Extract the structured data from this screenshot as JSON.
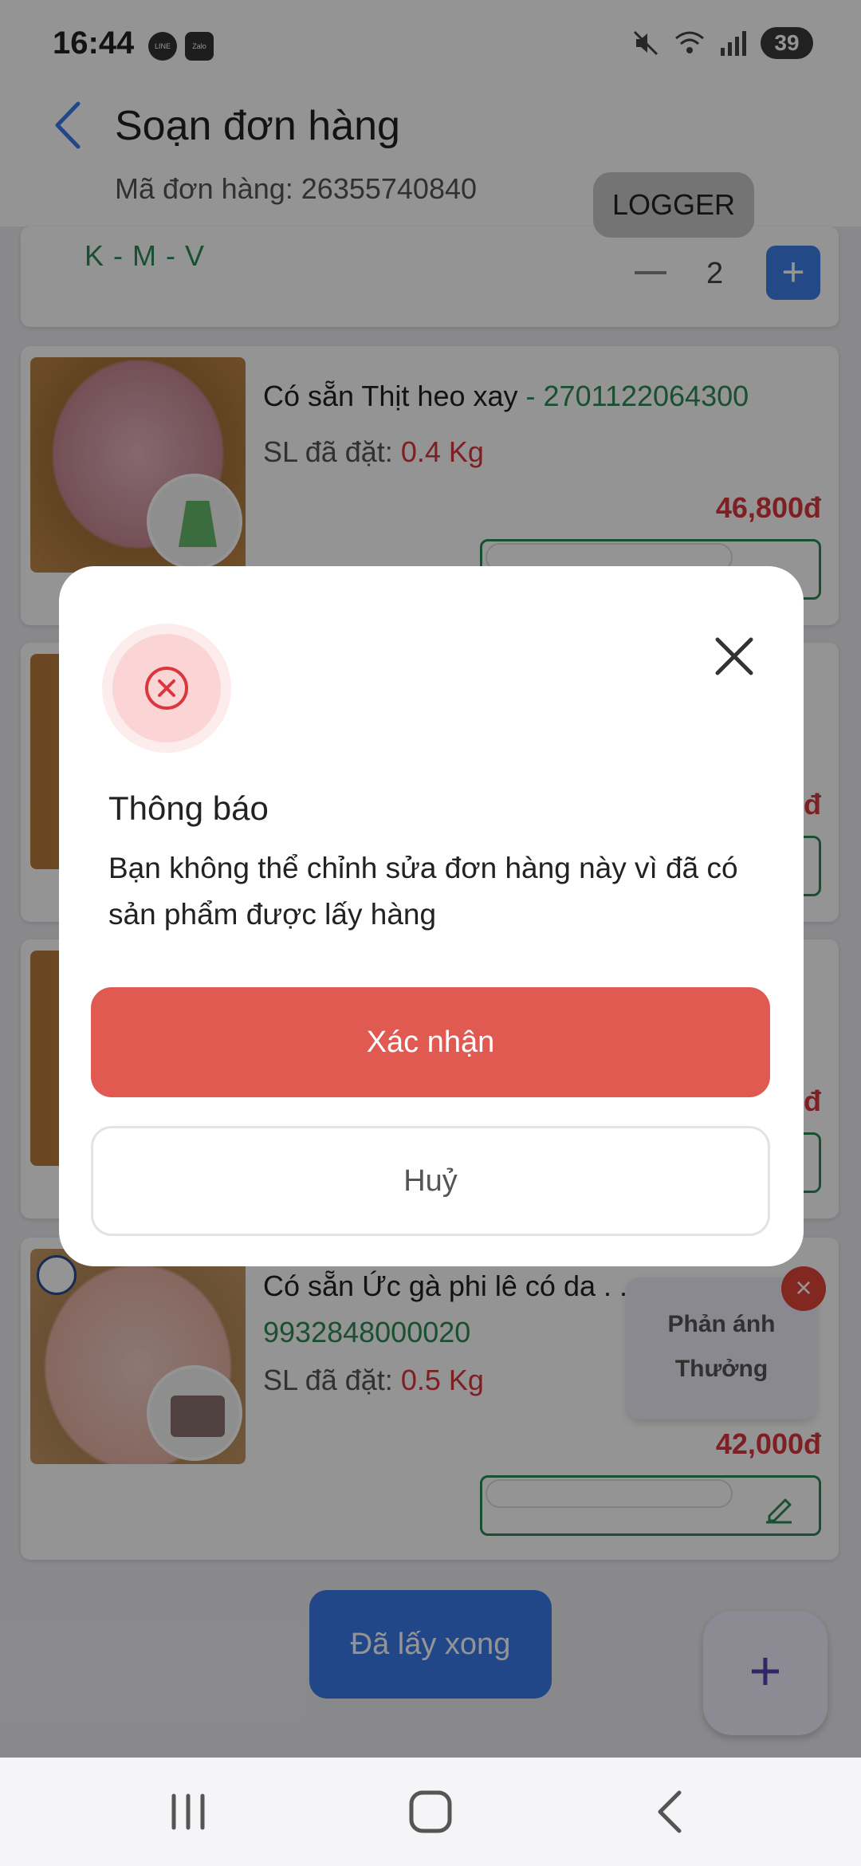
{
  "status_bar": {
    "time": "16:44",
    "apps": [
      "LINE",
      "Zalo"
    ],
    "battery": "39",
    "icons": [
      "mute-icon",
      "wifi-icon",
      "signal-icon"
    ]
  },
  "header": {
    "title": "Soạn đơn hàng",
    "order_label": "Mã đơn hàng:",
    "order_number": "26355740840",
    "logger_label": "LOGGER"
  },
  "first_item": {
    "variant": "K - M - V",
    "minus": "−",
    "quantity": "2",
    "plus": "+"
  },
  "products": [
    {
      "name": "Có sẵn Thịt heo xay",
      "sku": " - 2701122064300",
      "ordered_label": "SL đã đặt:",
      "ordered_value": "0.4 Kg",
      "price": "46,800đ"
    },
    {
      "name": "Có sẵn Ức gà phi lê có da . .",
      "sku": "9932848000020",
      "ordered_label": "SL đã đặt:",
      "ordered_value": "0.5 Kg",
      "price": "42,000đ"
    }
  ],
  "partial_prices": [
    "đ",
    "đ"
  ],
  "feedback": {
    "line1": "Phản ánh",
    "line2": "Thưởng",
    "close": "×"
  },
  "done_label": "Đã lấy xong",
  "add_label": "+",
  "modal": {
    "title": "Thông báo",
    "message": "Bạn không thể chỉnh sửa đơn hàng này vì đã có sản phẩm được lấy hàng",
    "confirm_label": "Xác nhận",
    "cancel_label": "Huỷ"
  },
  "colors": {
    "accent_blue": "#3b7bea",
    "sku_green": "#2e8b57",
    "price_red": "#d9363e",
    "confirm_red": "#e05a52"
  }
}
